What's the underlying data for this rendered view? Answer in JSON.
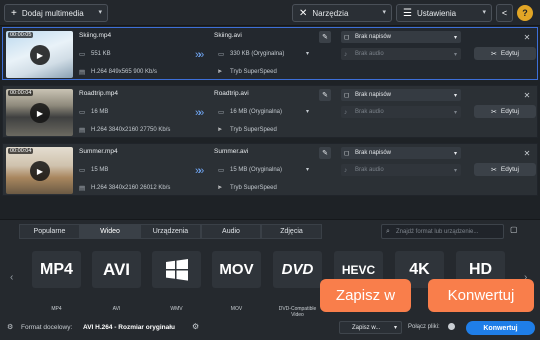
{
  "toolbar": {
    "add_label": "Dodaj multimedia",
    "tools_label": "Narzędzia",
    "settings_label": "Ustawienia",
    "share_icon": "share-icon",
    "help_icon": "help-icon"
  },
  "files": [
    {
      "timestamp": "00:00:05",
      "name": "Skiing.mp4",
      "size": "551 KB",
      "codec": "H.264 849x565 900 Kb/s",
      "output_name": "Skiing.avi",
      "output_size": "330 KB (Oryginalna)",
      "mode": "Tryb SuperSpeed",
      "subtitles": "Brak napisów",
      "audio": "Brak audio",
      "edit_label": "Edytuj"
    },
    {
      "timestamp": "00:00:04",
      "name": "Roadtrip.mp4",
      "size": "16 MB",
      "codec": "H.264 3840x2160 27750 Kb/s",
      "output_name": "Roadtrip.avi",
      "output_size": "16 MB (Oryginalna)",
      "mode": "Tryb SuperSpeed",
      "subtitles": "Brak napisów",
      "audio": "Brak audio",
      "edit_label": "Edytuj"
    },
    {
      "timestamp": "00:00:04",
      "name": "Summer.mp4",
      "size": "15 MB",
      "codec": "H.264 3840x2160 26012 Kb/s",
      "output_name": "Summer.avi",
      "output_size": "15 MB (Oryginalna)",
      "mode": "Tryb SuperSpeed",
      "subtitles": "Brak napisów",
      "audio": "Brak audio",
      "edit_label": "Edytuj"
    }
  ],
  "tabs": [
    "Popularne",
    "Wideo",
    "Urządzenia",
    "Audio",
    "Zdjęcia"
  ],
  "active_tab": "Wideo",
  "search": {
    "placeholder": "Znajdź format lub urządzenie..."
  },
  "formats": [
    {
      "title": "MP4",
      "sub": "VIDEO",
      "label": "MP4"
    },
    {
      "title": "AVI",
      "sub": "VIDEO",
      "label": "AVI"
    },
    {
      "title": "",
      "sub": "",
      "label": "WMV"
    },
    {
      "title": "MOV",
      "sub": "VIDEO",
      "label": "MOV"
    },
    {
      "title": "DVD",
      "sub": "VIDEO",
      "label": "DVD-Compatible Video"
    },
    {
      "title": "HEVC",
      "sub": "VIDEO",
      "label": "H.265"
    },
    {
      "title": "4K",
      "sub": "ULTRA HD",
      "label": "4K Ultra HD"
    },
    {
      "title": "HD",
      "sub": "VIDEO",
      "label": "HD Video"
    }
  ],
  "status": {
    "format_label": "Format docelowy:",
    "format_value": "AVI H.264 - Rozmiar oryginału",
    "save_to_short": "Zapisz w...",
    "merge_label": "Połącz pliki:",
    "convert_label": "Konwertuj"
  },
  "callouts": {
    "save": "Zapisz w",
    "convert": "Konwertuj"
  },
  "colors": {
    "accent": "#1f7ee8",
    "callout": "#f97e4b",
    "selection": "#3d6fd8"
  }
}
